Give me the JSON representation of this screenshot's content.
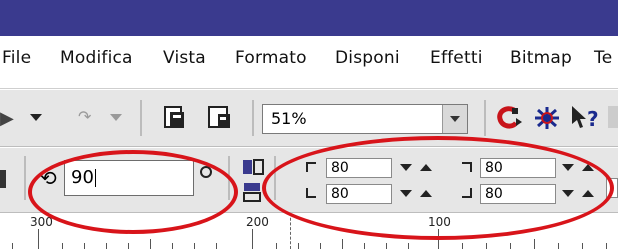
{
  "menubar": {
    "items": [
      {
        "label": "File"
      },
      {
        "label": "Modifica"
      },
      {
        "label": "Vista"
      },
      {
        "label": "Formato"
      },
      {
        "label": "Disponi"
      },
      {
        "label": "Effetti"
      },
      {
        "label": "Bitmap"
      },
      {
        "label": "Te"
      }
    ]
  },
  "toolbar": {
    "zoom_value": "51%"
  },
  "property_bar": {
    "rotation_value": "90",
    "corner_top_left": "80",
    "corner_top_right": "80",
    "corner_bottom_left": "80",
    "corner_bottom_right": "80"
  },
  "ruler": {
    "labels": [
      "300",
      "200",
      "100"
    ]
  },
  "colors": {
    "titlebar": "#3a3a8e",
    "toolbar_bg": "#e6e6e6",
    "highlight_ellipse": "#d8141a"
  }
}
